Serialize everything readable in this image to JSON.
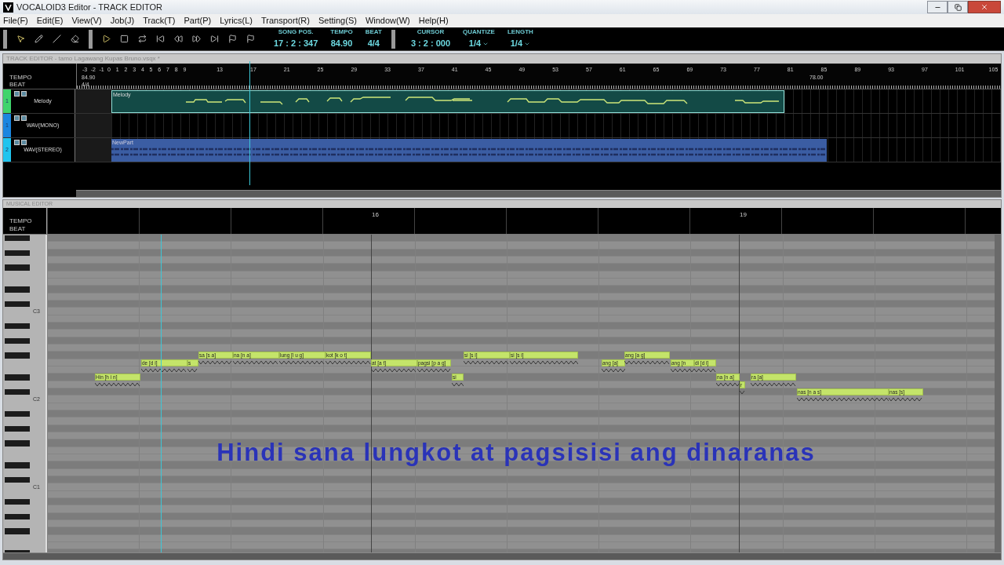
{
  "window": {
    "title": "VOCALOID3 Editor - TRACK EDITOR"
  },
  "menu": [
    "File(F)",
    "Edit(E)",
    "View(V)",
    "Job(J)",
    "Track(T)",
    "Part(P)",
    "Lyrics(L)",
    "Transport(R)",
    "Setting(S)",
    "Window(W)",
    "Help(H)"
  ],
  "toolbar": {
    "readouts": [
      {
        "label": "SONG POS.",
        "value": "17 : 2 : 347",
        "kind": "text"
      },
      {
        "label": "TEMPO",
        "value": "84.90",
        "kind": "text"
      },
      {
        "label": "BEAT",
        "value": "4/4",
        "kind": "text"
      }
    ],
    "cursor": [
      {
        "label": "CURSOR",
        "value": "3 : 2 : 000",
        "kind": "text"
      },
      {
        "label": "QUANTIZE",
        "value": "1/4",
        "kind": "dropdown"
      },
      {
        "label": "LENGTH",
        "value": "1/4",
        "kind": "dropdown"
      }
    ]
  },
  "track_editor": {
    "title": "TRACK EDITOR - tamo Lagawang Kupas Bruno.vsqx *",
    "tempo_label": "TEMPO",
    "beat_label": "BEAT",
    "tempo": "84.90",
    "beat": "4/4",
    "tempo_change": "78.00",
    "bars": [
      "-3",
      "-2",
      "-1",
      "0",
      "1",
      "2",
      "3",
      "4",
      "5",
      "6",
      "7",
      "8",
      "9",
      "13",
      "17",
      "21",
      "25",
      "29",
      "33",
      "37",
      "41",
      "45",
      "49",
      "53",
      "57",
      "61",
      "65",
      "69",
      "73",
      "77",
      "81",
      "85",
      "89",
      "93",
      "97",
      "101",
      "105"
    ],
    "tracks": [
      {
        "number": "1",
        "name": "Melody",
        "color": "#3fd46c",
        "kind": "vocal",
        "part": "Melody"
      },
      {
        "number": "1",
        "name": "WAV(MONO)",
        "color": "#1b86e0",
        "kind": "empty"
      },
      {
        "number": "2",
        "name": "WAV(STEREO)",
        "color": "#20c4ee",
        "kind": "audio",
        "part": "NewPart"
      }
    ]
  },
  "musical_editor": {
    "title": "MUSICAL EDITOR",
    "tempo_label": "TEMPO",
    "beat_label": "BEAT",
    "bars": [
      "16",
      "19"
    ],
    "octaves": [
      "C3",
      "C2",
      "C1"
    ],
    "notes": [
      {
        "lyric": "Hin [h i n]"
      },
      {
        "lyric": "de [d i]"
      },
      {
        "lyric": "s"
      },
      {
        "lyric": "sa [s a]"
      },
      {
        "lyric": "na [n a]"
      },
      {
        "lyric": "lung [l u g]"
      },
      {
        "lyric": "kot [k o t]"
      },
      {
        "lyric": "at [a t]"
      },
      {
        "lyric": "pagsi [p a g]"
      },
      {
        "lyric": "si"
      },
      {
        "lyric": "si [s i]"
      },
      {
        "lyric": "si [s i]"
      },
      {
        "lyric": "ang [a]"
      },
      {
        "lyric": "ang [a g]"
      },
      {
        "lyric": "ang [n"
      },
      {
        "lyric": "di [d i]"
      },
      {
        "lyric": "na [n a]"
      },
      {
        "lyric": "r"
      },
      {
        "lyric": "ra [a]"
      },
      {
        "lyric": "nas [n a s]"
      },
      {
        "lyric": "nas [s]"
      }
    ],
    "subtitle": "Hindi sana lungkot at pagsisisi ang dinaranas"
  }
}
